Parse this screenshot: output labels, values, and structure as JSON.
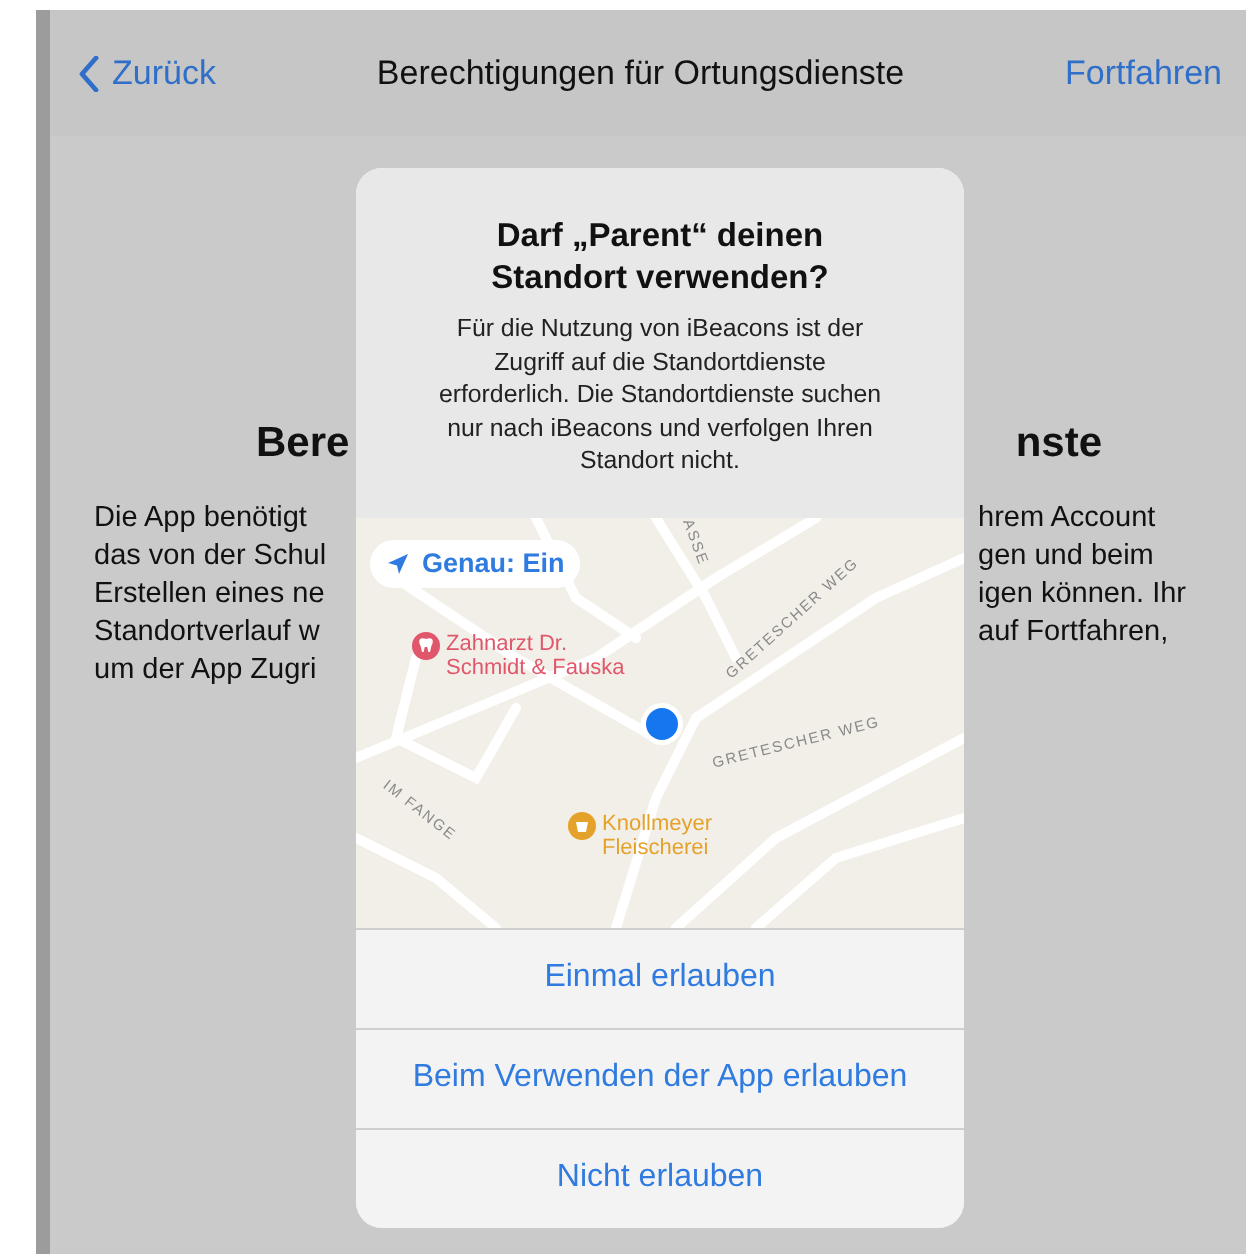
{
  "nav": {
    "back": "Zurück",
    "title": "Berechtigungen für Ortungsdienste",
    "action": "Fortfahren"
  },
  "background": {
    "heading_left": "Bere",
    "heading_right": "nste",
    "text_left": [
      "Die App benötigt",
      "das von der Schul",
      "Erstellen eines ne",
      "Standortverlauf w",
      "um der App Zugri"
    ],
    "text_right": [
      "hrem Account",
      "gen und beim",
      "igen können. Ihr",
      "auf Fortfahren,"
    ]
  },
  "alert": {
    "title": "Darf „Parent“ deinen Standort verwenden?",
    "message": "Für die Nutzung von iBeacons ist der Zugriff auf die Standortdienste erforderlich. Die Standortdienste suchen nur nach iBeacons und verfolgen Ihren Standort nicht.",
    "precise": "Genau: Ein",
    "map": {
      "streets": [
        "ASSE",
        "GRETESCHER WEG",
        "GRETESCHER WEG",
        "IM FANGE"
      ],
      "places": [
        {
          "name": "Zahnarzt Dr.\nSchmidt & Fauska",
          "kind": "dentist",
          "color": "#e0566a"
        },
        {
          "name": "Knollmeyer\nFleischerei",
          "kind": "butcher",
          "color": "#e5a22a"
        }
      ]
    },
    "buttons": [
      "Einmal erlauben",
      "Beim Verwenden der App erlauben",
      "Nicht erlauben"
    ]
  }
}
